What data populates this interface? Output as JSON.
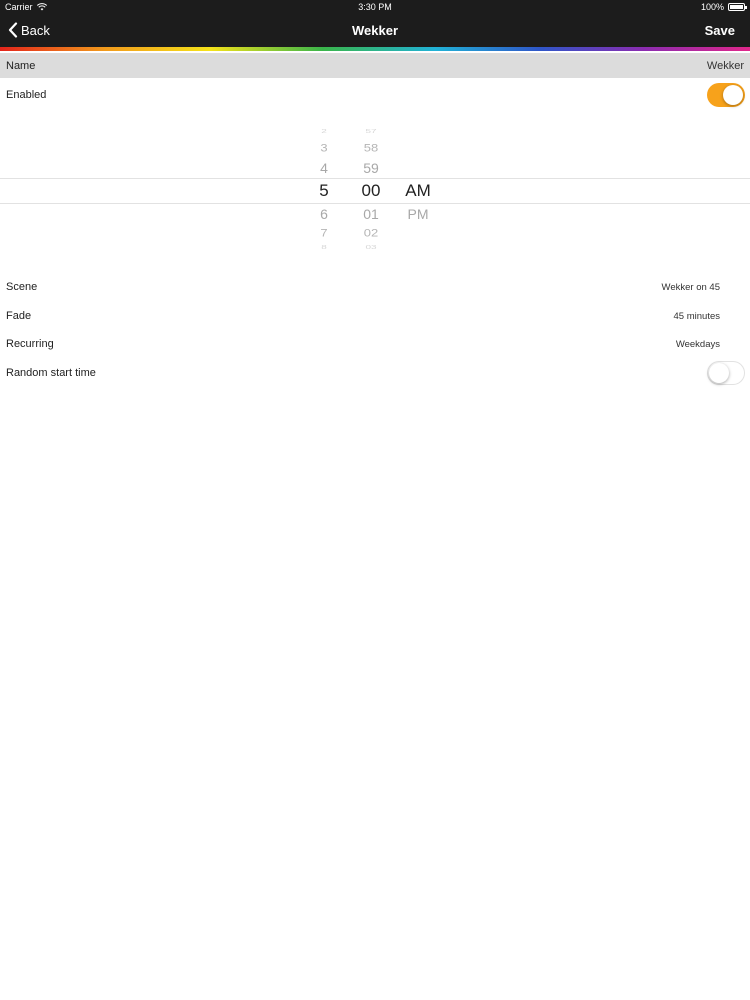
{
  "status_bar": {
    "carrier": "Carrier",
    "time": "3:30 PM",
    "battery": "100%"
  },
  "nav": {
    "back_label": "Back",
    "title": "Wekker",
    "save_label": "Save"
  },
  "name": {
    "label": "Name",
    "value": "Wekker"
  },
  "enabled": {
    "label": "Enabled",
    "on": true
  },
  "picker": {
    "hour": [
      "2",
      "3",
      "4",
      "5",
      "6",
      "7",
      "8"
    ],
    "minute": [
      "57",
      "58",
      "59",
      "00",
      "01",
      "02",
      "03"
    ],
    "ampm": [
      "AM",
      "PM"
    ],
    "selected": {
      "hour": "5",
      "minute": "00",
      "ampm": "AM"
    }
  },
  "scene": {
    "label": "Scene",
    "value": "Wekker on 45"
  },
  "fade": {
    "label": "Fade",
    "value": "45 minutes"
  },
  "recurring": {
    "label": "Recurring",
    "value": "Weekdays"
  },
  "random_start": {
    "label": "Random start time",
    "on": false
  },
  "colors": {
    "accent": "#f7a21b",
    "bar": "#1c1c1c",
    "name_row": "#dcdcdc"
  }
}
